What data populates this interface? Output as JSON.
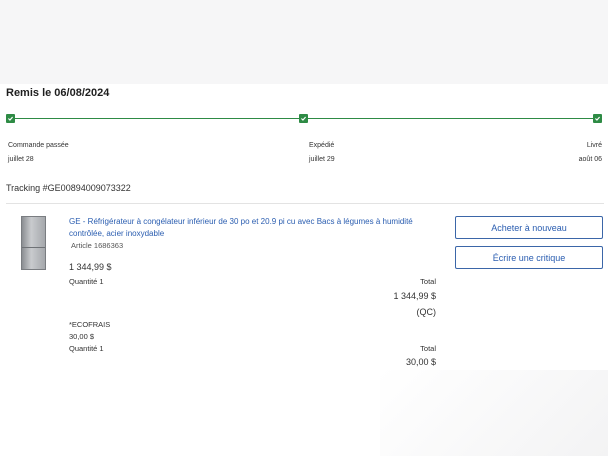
{
  "order": {
    "status_title": "Remis le 06/08/2024",
    "steps": [
      {
        "label": "Commande passée",
        "date": "juillet 28"
      },
      {
        "label": "Expédié",
        "date": "juillet 29"
      },
      {
        "label": "Livré",
        "date": "août 06"
      }
    ],
    "tracking": "Tracking #GE00894009073322"
  },
  "item": {
    "name": "GE - Réfrigérateur à congélateur inférieur de 30 po et 20.9 pi cu avec Bacs à légumes à humidité contrôlée, acier inoxydable",
    "article": "Article 1686363",
    "price": "1 344,99 $",
    "quantity": "Quantité 1",
    "total_label": "Total",
    "total_value": "1 344,99 $",
    "province": "(QC)"
  },
  "fee": {
    "name": "*ECOFRAIS",
    "price": "30,00 $",
    "quantity": "Quantité 1",
    "total_label": "Total",
    "total_value": "30,00 $"
  },
  "actions": {
    "buy_again": "Acheter à nouveau",
    "write_review": "Écrire une critique"
  },
  "colors": {
    "progress": "#2e8b45",
    "link": "#2a5db0"
  }
}
